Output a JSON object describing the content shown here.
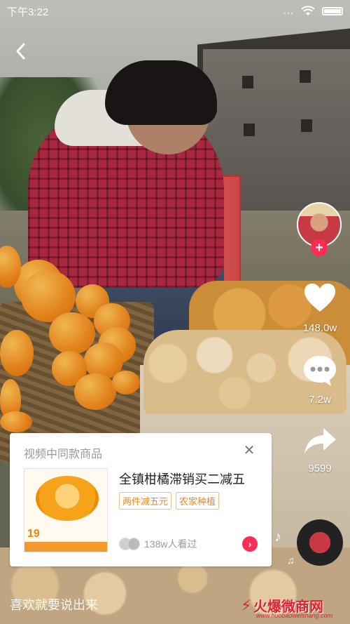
{
  "status_bar": {
    "time": "下午3:22",
    "signal": "...",
    "wifi": "wifi-icon",
    "battery": "battery-icon"
  },
  "colors": {
    "accent_red": "#fe2c55",
    "tag_orange": "#e6891c",
    "watermark_red": "#e0242e"
  },
  "actions": {
    "like_count": "148.0w",
    "comment_count": "7.2w",
    "share_count": "9599"
  },
  "product_card": {
    "header": "视频中同款商品",
    "title": "全镇柑橘滞销买二减五",
    "tags": [
      "两件减五元",
      "农家种植"
    ],
    "viewers": "138w人看过",
    "thumb_price": "19"
  },
  "comment_input": {
    "placeholder": "喜欢就要说出来"
  },
  "watermark": {
    "brand": "火爆微商网",
    "url": "www.huobaoweishang.com"
  }
}
